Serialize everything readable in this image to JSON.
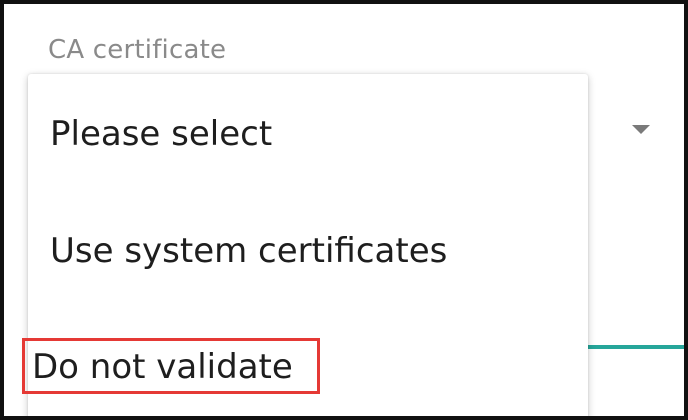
{
  "field": {
    "label": "CA certificate",
    "dropdown_icon": "arrow-drop-down-icon",
    "underline_color": "#26a69a"
  },
  "menu": {
    "items": [
      {
        "label": "Please select"
      },
      {
        "label": "Use system certificates"
      },
      {
        "label": "Do not validate",
        "highlighted": true
      }
    ]
  },
  "colors": {
    "label": "#8a8a8a",
    "menu_text": "#1e1e1e",
    "highlight": "#e53935",
    "accent": "#26a69a"
  }
}
